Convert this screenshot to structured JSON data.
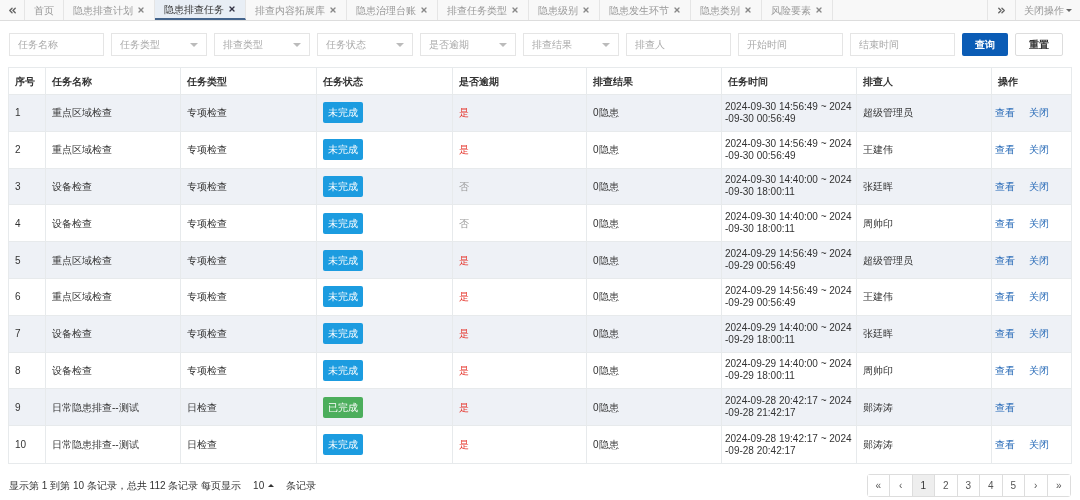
{
  "tabs": [
    {
      "label": "首页",
      "selected": false,
      "closable": false
    },
    {
      "label": "隐患排查计划",
      "selected": false,
      "closable": true
    },
    {
      "label": "隐患排查任务",
      "selected": true,
      "closable": true
    },
    {
      "label": "排查内容拓展库",
      "selected": false,
      "closable": true
    },
    {
      "label": "隐患治理台账",
      "selected": false,
      "closable": true
    },
    {
      "label": "排查任务类型",
      "selected": false,
      "closable": true
    },
    {
      "label": "隐患级别",
      "selected": false,
      "closable": true
    },
    {
      "label": "隐患发生环节",
      "selected": false,
      "closable": true
    },
    {
      "label": "隐患类别",
      "selected": false,
      "closable": true
    },
    {
      "label": "风险要素",
      "selected": false,
      "closable": true
    }
  ],
  "close_menu": "关闭操作",
  "filters": [
    {
      "kind": "text",
      "placeholder": "任务名称"
    },
    {
      "kind": "select",
      "placeholder": "任务类型"
    },
    {
      "kind": "select",
      "placeholder": "排查类型"
    },
    {
      "kind": "select",
      "placeholder": "任务状态"
    },
    {
      "kind": "select",
      "placeholder": "是否逾期"
    },
    {
      "kind": "select",
      "placeholder": "排查结果"
    },
    {
      "kind": "text",
      "placeholder": "排查人"
    },
    {
      "kind": "text",
      "placeholder": "开始时间"
    },
    {
      "kind": "text",
      "placeholder": "结束时间"
    }
  ],
  "buttons": [
    {
      "label": "查询",
      "kind": "primary"
    },
    {
      "label": "重置",
      "kind": "default"
    }
  ],
  "table": {
    "columns": [
      "序号",
      "任务名称",
      "任务类型",
      "任务状态",
      "是否逾期",
      "排查结果",
      "任务时间",
      "排查人",
      "操作"
    ],
    "rows": [
      {
        "no": "1",
        "name": "重点区域检查",
        "type": "专项检查",
        "status": {
          "label": "未完成",
          "kind": "pending"
        },
        "overdue": {
          "label": "是",
          "on": true
        },
        "result": "0隐患",
        "time": "2024-09-30 14:56:49 ~ 2024-09-30 00:56:49",
        "inspector": "超级管理员",
        "actions": [
          "查看",
          "关闭"
        ]
      },
      {
        "no": "2",
        "name": "重点区域检查",
        "type": "专项检查",
        "status": {
          "label": "未完成",
          "kind": "pending"
        },
        "overdue": {
          "label": "是",
          "on": true
        },
        "result": "0隐患",
        "time": "2024-09-30 14:56:49 ~ 2024-09-30 00:56:49",
        "inspector": "王建伟",
        "actions": [
          "查看",
          "关闭"
        ]
      },
      {
        "no": "3",
        "name": "设备检查",
        "type": "专项检查",
        "status": {
          "label": "未完成",
          "kind": "pending"
        },
        "overdue": {
          "label": "否",
          "on": false
        },
        "result": "0隐患",
        "time": "2024-09-30 14:40:00 ~ 2024-09-30 18:00:11",
        "inspector": "张廷晖",
        "actions": [
          "查看",
          "关闭"
        ]
      },
      {
        "no": "4",
        "name": "设备检查",
        "type": "专项检查",
        "status": {
          "label": "未完成",
          "kind": "pending"
        },
        "overdue": {
          "label": "否",
          "on": false
        },
        "result": "0隐患",
        "time": "2024-09-30 14:40:00 ~ 2024-09-30 18:00:11",
        "inspector": "周帅印",
        "actions": [
          "查看",
          "关闭"
        ]
      },
      {
        "no": "5",
        "name": "重点区域检查",
        "type": "专项检查",
        "status": {
          "label": "未完成",
          "kind": "pending"
        },
        "overdue": {
          "label": "是",
          "on": true
        },
        "result": "0隐患",
        "time": "2024-09-29 14:56:49 ~ 2024-09-29 00:56:49",
        "inspector": "超级管理员",
        "actions": [
          "查看",
          "关闭"
        ]
      },
      {
        "no": "6",
        "name": "重点区域检查",
        "type": "专项检查",
        "status": {
          "label": "未完成",
          "kind": "pending"
        },
        "overdue": {
          "label": "是",
          "on": true
        },
        "result": "0隐患",
        "time": "2024-09-29 14:56:49 ~ 2024-09-29 00:56:49",
        "inspector": "王建伟",
        "actions": [
          "查看",
          "关闭"
        ]
      },
      {
        "no": "7",
        "name": "设备检查",
        "type": "专项检查",
        "status": {
          "label": "未完成",
          "kind": "pending"
        },
        "overdue": {
          "label": "是",
          "on": true
        },
        "result": "0隐患",
        "time": "2024-09-29 14:40:00 ~ 2024-09-29 18:00:11",
        "inspector": "张廷晖",
        "actions": [
          "查看",
          "关闭"
        ]
      },
      {
        "no": "8",
        "name": "设备检查",
        "type": "专项检查",
        "status": {
          "label": "未完成",
          "kind": "pending"
        },
        "overdue": {
          "label": "是",
          "on": true
        },
        "result": "0隐患",
        "time": "2024-09-29 14:40:00 ~ 2024-09-29 18:00:11",
        "inspector": "周帅印",
        "actions": [
          "查看",
          "关闭"
        ]
      },
      {
        "no": "9",
        "name": "日常隐患排查--测试",
        "type": "日检查",
        "status": {
          "label": "已完成",
          "kind": "done"
        },
        "overdue": {
          "label": "是",
          "on": true
        },
        "result": "0隐患",
        "time": "2024-09-28 20:42:17 ~ 2024-09-28 21:42:17",
        "inspector": "郧涛涛",
        "actions": [
          "查看"
        ]
      },
      {
        "no": "10",
        "name": "日常隐患排查--测试",
        "type": "日检查",
        "status": {
          "label": "未完成",
          "kind": "pending"
        },
        "overdue": {
          "label": "是",
          "on": true
        },
        "result": "0隐患",
        "time": "2024-09-28 19:42:17 ~ 2024-09-28 20:42:17",
        "inspector": "郧涛涛",
        "actions": [
          "查看",
          "关闭"
        ]
      }
    ]
  },
  "footer": {
    "summary": "显示第 1 到第 10 条记录，总共 112 条记录 每页显示",
    "page_size": "10",
    "suffix": "条记录"
  },
  "pagination": [
    {
      "label": "«",
      "selected": false
    },
    {
      "label": "‹",
      "selected": false
    },
    {
      "label": "1",
      "selected": true
    },
    {
      "label": "2",
      "selected": false
    },
    {
      "label": "3",
      "selected": false
    },
    {
      "label": "4",
      "selected": false
    },
    {
      "label": "5",
      "selected": false
    },
    {
      "label": "›",
      "selected": false
    },
    {
      "label": "»",
      "selected": false
    }
  ]
}
